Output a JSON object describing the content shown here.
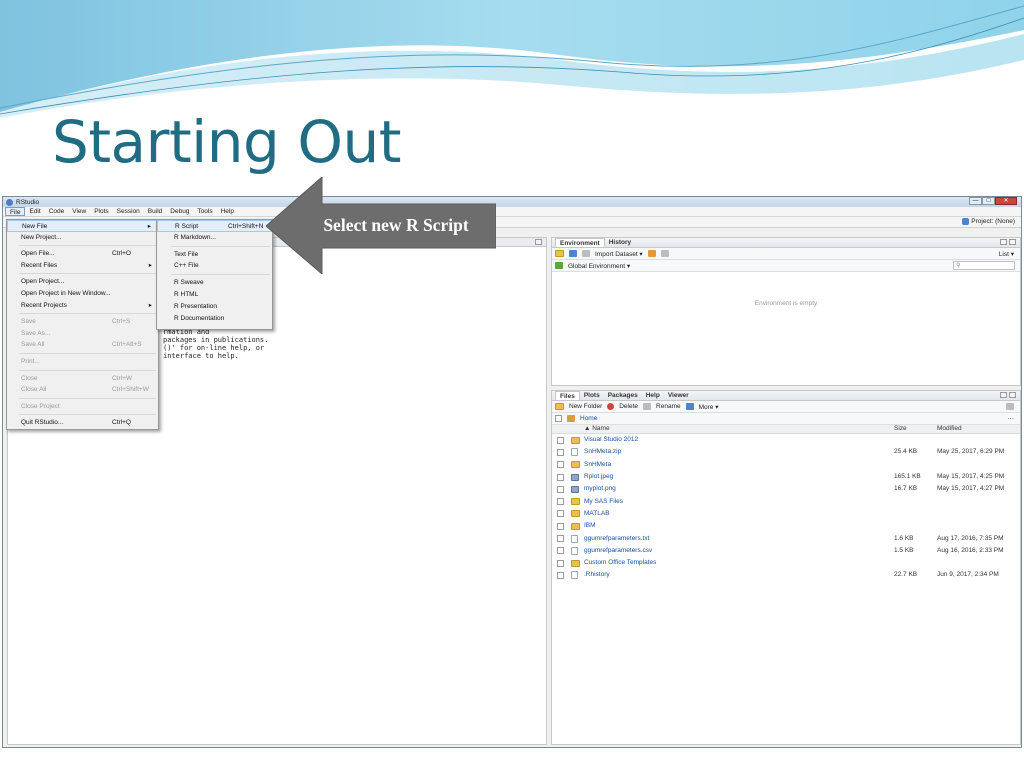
{
  "slide": {
    "title": "Starting Out"
  },
  "callout": {
    "text": "Select new R Script"
  },
  "window": {
    "title": "RStudio",
    "controls": [
      "—",
      "□",
      "✕"
    ]
  },
  "menubar": {
    "items": [
      "File",
      "Edit",
      "Code",
      "View",
      "Plots",
      "Session",
      "Build",
      "Debug",
      "Tools",
      "Help"
    ]
  },
  "toolbar": {
    "project_label": "Project: (None)"
  },
  "file_menu": {
    "new_file": "New File",
    "new_project": "New Project...",
    "open_file": "Open File...",
    "open_file_sc": "Ctrl+O",
    "recent_files": "Recent Files",
    "open_project": "Open Project...",
    "open_project_new_window": "Open Project in New Window...",
    "recent_projects": "Recent Projects",
    "save": "Save",
    "save_sc": "Ctrl+S",
    "save_as": "Save As...",
    "save_all": "Save All",
    "save_all_sc": "Ctrl+Alt+S",
    "print": "Print...",
    "close": "Close",
    "close_sc": "Ctrl+W",
    "close_all": "Close All",
    "close_all_sc": "Ctrl+Shift+W",
    "close_project": "Close Project",
    "quit": "Quit RStudio...",
    "quit_sc": "Ctrl+Q",
    "arrow": "▸"
  },
  "new_file_submenu": {
    "r_script": "R Script",
    "r_script_sc": "Ctrl+Shift+N",
    "r_markdown": "R Markdown...",
    "text_file": "Text File",
    "cpp_file": "C++ File",
    "r_sweave": "R Sweave",
    "r_html": "R HTML",
    "r_presentation": "R Presentation",
    "r_documentation": "R Documentation"
  },
  "console": {
    "lines": [
      "rmation and",
      "packages in publications.",
      "",
      "()' for on-line help, or",
      "interface to help."
    ]
  },
  "environment_pane": {
    "tabs": [
      "Environment",
      "History"
    ],
    "import_dataset": "Import Dataset ▾",
    "list_view": "List ▾",
    "scope": "Global Environment ▾",
    "search_placeholder": "",
    "empty_message": "Environment is empty"
  },
  "files_pane": {
    "tabs": [
      "Files",
      "Plots",
      "Packages",
      "Help",
      "Viewer"
    ],
    "new_folder": "New Folder",
    "delete": "Delete",
    "rename": "Rename",
    "more": "More ▾",
    "breadcrumb": "Home",
    "columns": {
      "name": "▲ Name",
      "size": "Size",
      "modified": "Modified"
    },
    "rows": [
      {
        "name": "Visual Studio 2012",
        "size": "",
        "modified": "",
        "icon": "folder"
      },
      {
        "name": "SnHMeta.zip",
        "size": "25.4 KB",
        "modified": "May 25, 2017, 6:29 PM",
        "icon": "file"
      },
      {
        "name": "SnHMeta",
        "size": "",
        "modified": "",
        "icon": "folder"
      },
      {
        "name": "Rplot.jpeg",
        "size": "165.1 KB",
        "modified": "May 15, 2017, 4:25 PM",
        "icon": "img"
      },
      {
        "name": "myplot.png",
        "size": "16.7 KB",
        "modified": "May 15, 2017, 4:27 PM",
        "icon": "img"
      },
      {
        "name": "My SAS Files",
        "size": "",
        "modified": "",
        "icon": "folder"
      },
      {
        "name": "MATLAB",
        "size": "",
        "modified": "",
        "icon": "folder"
      },
      {
        "name": "IBM",
        "size": "",
        "modified": "",
        "icon": "folder"
      },
      {
        "name": "ggumrefparameters.txt",
        "size": "1.6 KB",
        "modified": "Aug 17, 2016, 7:35 PM",
        "icon": "file"
      },
      {
        "name": "ggumrefparameters.csv",
        "size": "1.5 KB",
        "modified": "Aug 16, 2016, 2:33 PM",
        "icon": "file"
      },
      {
        "name": "Custom Office Templates",
        "size": "",
        "modified": "",
        "icon": "folder"
      },
      {
        "name": ".Rhistory",
        "size": "22.7 KB",
        "modified": "Jun 9, 2017, 2:34 PM",
        "icon": "file"
      }
    ]
  }
}
